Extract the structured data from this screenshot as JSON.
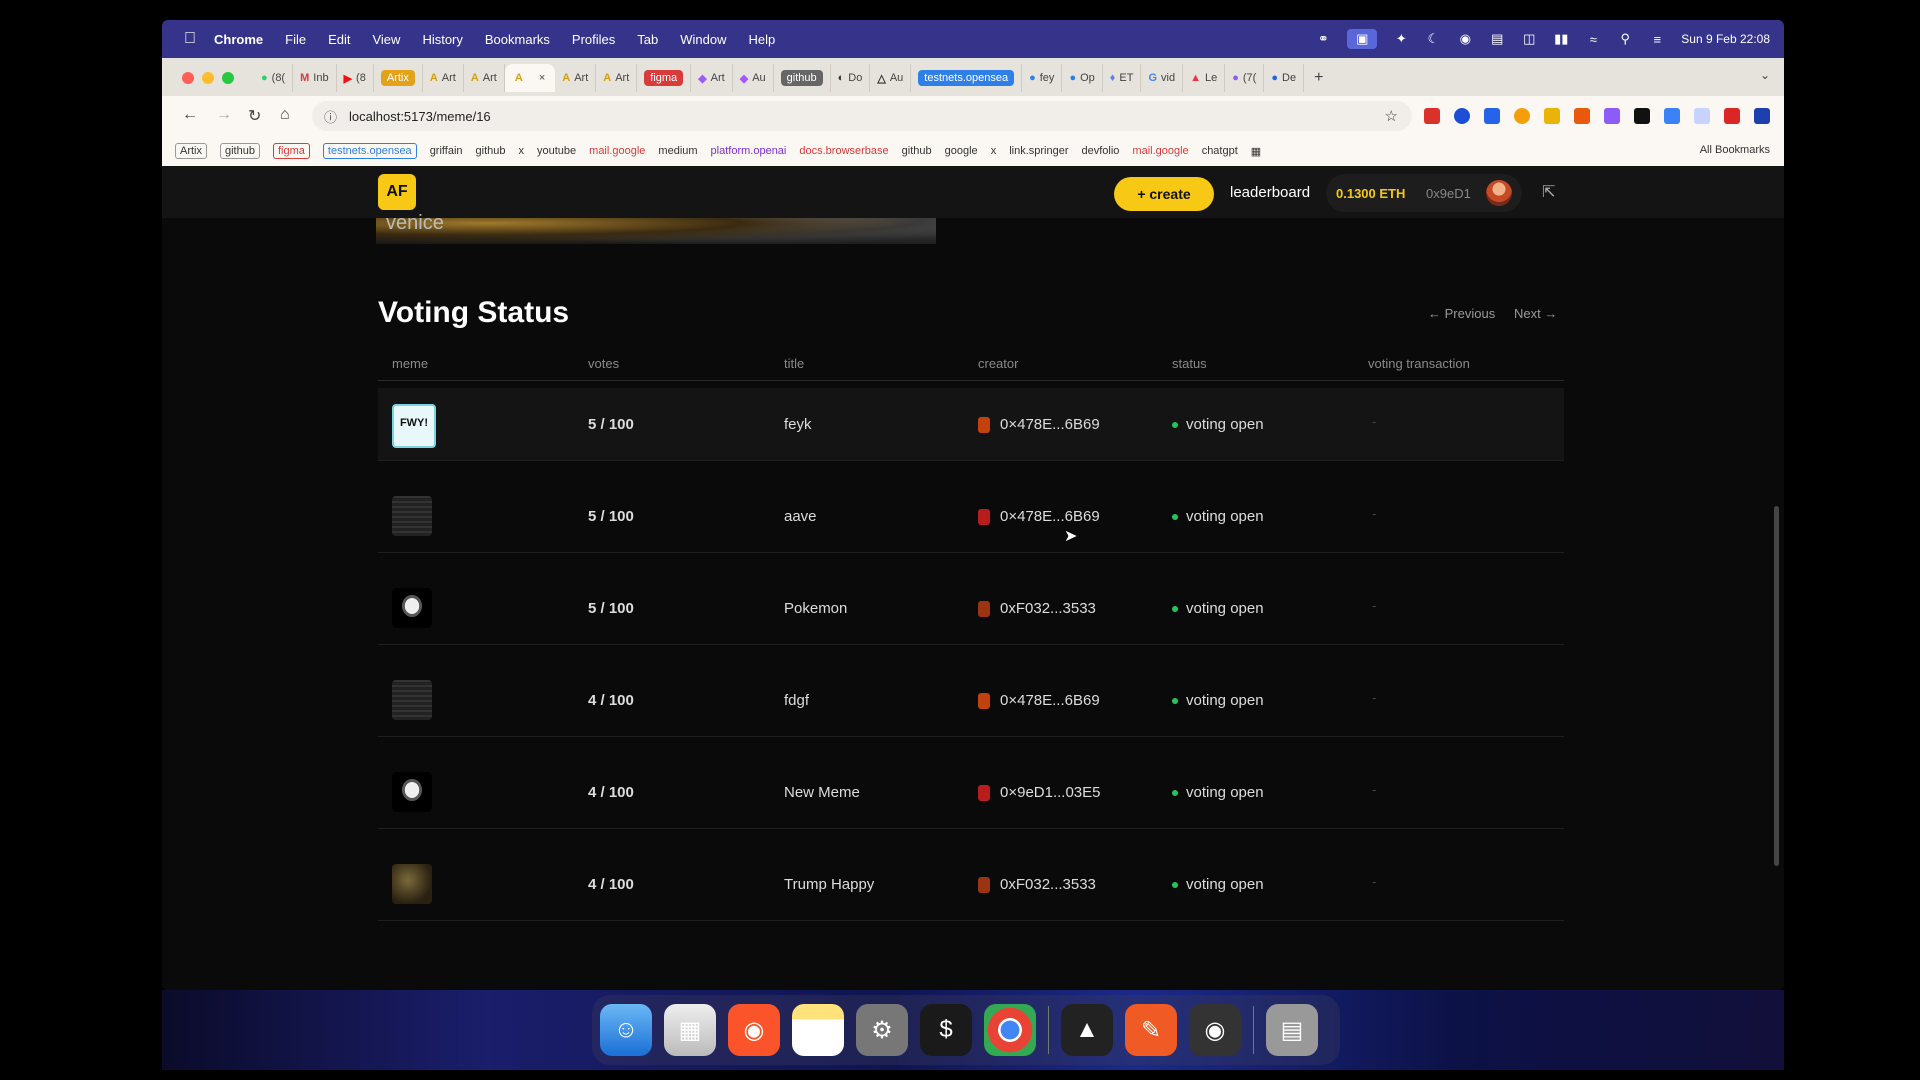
{
  "menubar": {
    "app": "Chrome",
    "items": [
      "File",
      "Edit",
      "View",
      "History",
      "Bookmarks",
      "Profiles",
      "Tab",
      "Window",
      "Help"
    ],
    "datetime": "Sun 9 Feb  22:08"
  },
  "tabs": [
    {
      "icon": "chat",
      "label": "(8("
    },
    {
      "icon": "gmail",
      "label": "Inb"
    },
    {
      "icon": "youtube",
      "label": "(8"
    },
    {
      "icon": "pill",
      "label": "Artix",
      "color": "#e3a21a"
    },
    {
      "icon": "af",
      "label": "Art"
    },
    {
      "icon": "af",
      "label": "Art"
    },
    {
      "icon": "af",
      "label": "",
      "active": true,
      "close": "×"
    },
    {
      "icon": "af",
      "label": "Art"
    },
    {
      "icon": "af",
      "label": "Art"
    },
    {
      "icon": "pill",
      "label": "figma",
      "color": "#d93a3a"
    },
    {
      "icon": "figma",
      "label": "Art"
    },
    {
      "icon": "figma",
      "label": "Au"
    },
    {
      "icon": "pill",
      "label": "github",
      "color": "#666"
    },
    {
      "icon": "do",
      "label": "Do"
    },
    {
      "icon": "tri",
      "label": "Au"
    },
    {
      "icon": "pill",
      "label": "testnets.opensea",
      "color": "#2f7fe8"
    },
    {
      "icon": "os",
      "label": "fey"
    },
    {
      "icon": "os",
      "label": "Op"
    },
    {
      "icon": "et",
      "label": "ET"
    },
    {
      "icon": "g",
      "label": "vid"
    },
    {
      "icon": "le",
      "label": "Le"
    },
    {
      "icon": "pu",
      "label": "(7("
    },
    {
      "icon": "de",
      "label": "De"
    }
  ],
  "address": {
    "url": "localhost:5173/meme/16"
  },
  "bookmarks": [
    {
      "label": "Artix",
      "box": true,
      "color": "#333"
    },
    {
      "label": "github",
      "box": true,
      "color": "#333"
    },
    {
      "label": "figma",
      "box": true,
      "color": "#d93a3a"
    },
    {
      "label": "testnets.opensea",
      "box": true,
      "color": "#2f7fe8"
    },
    {
      "label": "griffain",
      "color": "#333"
    },
    {
      "label": "github",
      "color": "#333"
    },
    {
      "label": "x",
      "color": "#333"
    },
    {
      "label": "youtube",
      "color": "#333"
    },
    {
      "label": "mail.google",
      "color": "#d93a3a"
    },
    {
      "label": "medium",
      "color": "#333"
    },
    {
      "label": "platform.openai",
      "color": "#7a2fd0"
    },
    {
      "label": "docs.browserbase",
      "color": "#d93a3a"
    },
    {
      "label": "github",
      "color": "#333"
    },
    {
      "label": "google",
      "color": "#333"
    },
    {
      "label": "x",
      "color": "#333"
    },
    {
      "label": "link.springer",
      "color": "#333"
    },
    {
      "label": "devfolio",
      "color": "#333"
    },
    {
      "label": "mail.google",
      "color": "#d93a3a"
    },
    {
      "label": "chatgpt",
      "color": "#333"
    }
  ],
  "all_bookmarks": "All Bookmarks",
  "app": {
    "logo": "AF",
    "hero_text": "venice",
    "create": "+ create",
    "leaderboard": "leaderboard",
    "balance": "0.1300 ETH",
    "wallet_addr": "0x9eD1"
  },
  "section": {
    "title": "Voting Status",
    "previous": "← Previous",
    "next": "Next →"
  },
  "columns": [
    "meme",
    "votes",
    "title",
    "creator",
    "status",
    "voting transaction"
  ],
  "rows": [
    {
      "thumb": "fwy",
      "votes": "5 / 100",
      "title": "feyk",
      "creator": "0×478E...6B69",
      "status": "voting open",
      "tx": "-"
    },
    {
      "thumb": "dark",
      "votes": "5 / 100",
      "title": "aave",
      "creator": "0×478E...6B69",
      "status": "voting open",
      "tx": "-"
    },
    {
      "thumb": "sketch",
      "votes": "5 / 100",
      "title": "Pokemon",
      "creator": "0xF032...3533",
      "status": "voting open",
      "tx": "-"
    },
    {
      "thumb": "dark",
      "votes": "4 / 100",
      "title": "fdgf",
      "creator": "0×478E...6B69",
      "status": "voting open",
      "tx": "-"
    },
    {
      "thumb": "sketch",
      "votes": "4 / 100",
      "title": "New Meme",
      "creator": "0×9eD1...03E5",
      "status": "voting open",
      "tx": "-"
    },
    {
      "thumb": "photo",
      "votes": "4 / 100",
      "title": "Trump Happy",
      "creator": "0xF032...3533",
      "status": "voting open",
      "tx": "-"
    }
  ],
  "colors": {
    "accent": "#f7c915",
    "status_dot": "#22c55e",
    "menubar": "#35348a"
  },
  "dock": [
    "finder-icon",
    "launchpad-icon",
    "brave-icon",
    "notes-icon",
    "settings-icon",
    "terminal-icon",
    "chrome-icon",
    "cursor-app-icon",
    "pen-icon",
    "obs-icon",
    "trash-icon"
  ]
}
